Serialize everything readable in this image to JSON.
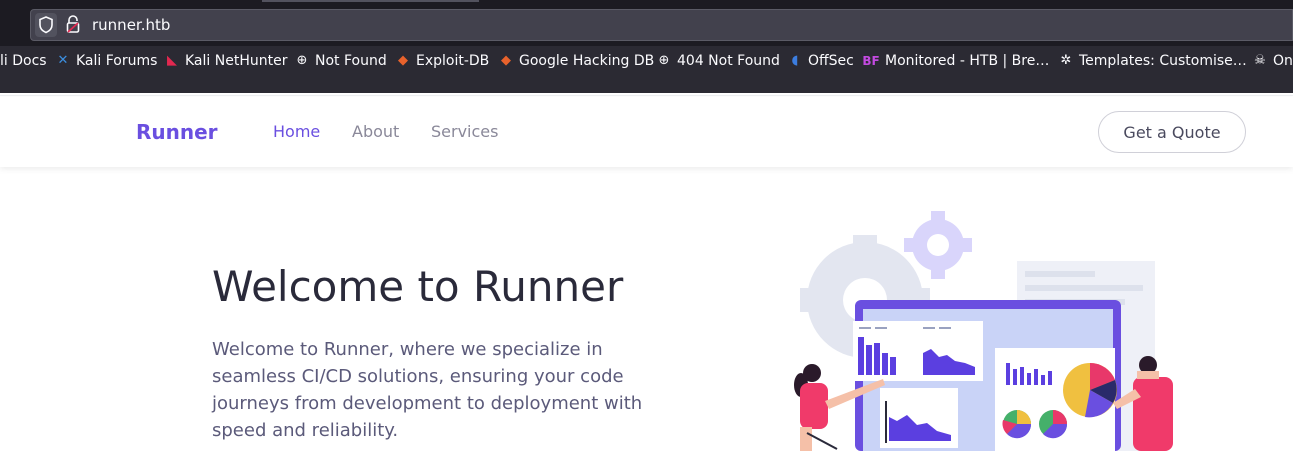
{
  "browser": {
    "url": "runner.htb",
    "bookmarks": [
      {
        "label": "li Docs",
        "icon": "kali-docs-icon"
      },
      {
        "label": "Kali Forums",
        "icon": "kali-forums-icon"
      },
      {
        "label": "Kali NetHunter",
        "icon": "kali-nethunter-icon"
      },
      {
        "label": "Not Found",
        "icon": "globe-icon"
      },
      {
        "label": "Exploit-DB",
        "icon": "exploit-db-icon"
      },
      {
        "label": "Google Hacking DB",
        "icon": "ghdb-icon"
      },
      {
        "label": "404 Not Found",
        "icon": "globe-icon"
      },
      {
        "label": "OffSec",
        "icon": "offsec-icon"
      },
      {
        "label": "Monitored - HTB | Bre…",
        "icon": "bf-icon"
      },
      {
        "label": "Templates: Customise…",
        "icon": "joomla-icon"
      },
      {
        "label": "On",
        "icon": "skull-icon"
      }
    ]
  },
  "site": {
    "brand": "Runner",
    "nav": {
      "home": "Home",
      "about": "About",
      "services": "Services"
    },
    "cta": "Get a Quote",
    "hero": {
      "title": "Welcome to Runner",
      "text": "Welcome to Runner, where we specialize in seamless CI/CD solutions, ensuring your code journeys from development to deployment with speed and reliability."
    }
  },
  "colors": {
    "accent": "#6a4fe0",
    "nav_inactive": "#8a8899",
    "chrome_bg": "#2b2a33"
  }
}
